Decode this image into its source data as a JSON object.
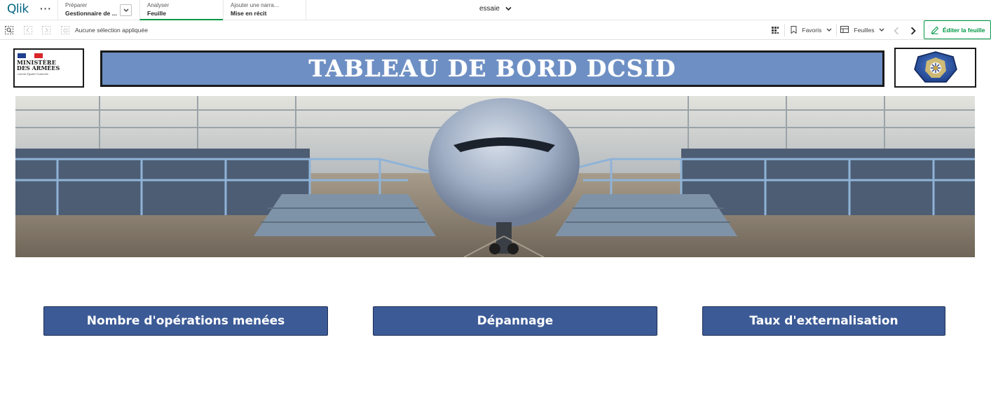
{
  "topnav": {
    "logo": "Qlik",
    "more_label": "···",
    "tabs": [
      {
        "small": "Préparer",
        "big": "Gestionnaire de ..."
      },
      {
        "small": "Analyser",
        "big": "Feuille"
      },
      {
        "small": "Ajouter une narra...",
        "big": "Mise en récit"
      }
    ],
    "app_title": "essaie"
  },
  "toolbar": {
    "selection_text": "Aucune sélection appliquée",
    "favorites_label": "Favoris",
    "sheets_label": "Feuilles",
    "edit_label": "Éditer la feuille"
  },
  "sheet": {
    "ministry_logo": {
      "line1": "MINISTÈRE",
      "line2": "DES ARMÉES",
      "motto": "Liberté Égalité Fraternité"
    },
    "title": "TABLEAU DE BORD DCSID",
    "buttons": {
      "operations": "Nombre d'opérations menées",
      "depannage": "Dépannage",
      "externalisation": "Taux d'externalisation"
    }
  },
  "colors": {
    "accent_green": "#009845",
    "banner_blue": "#6d8fc4",
    "button_blue": "#3c5a96",
    "qlik_teal": "#006580"
  },
  "icons": [
    "smart-search-icon",
    "step-back-icon",
    "step-forward-icon",
    "clear-selections-icon",
    "grid-icon",
    "bookmark-icon",
    "sheets-icon",
    "prev-icon",
    "next-icon",
    "edit-pencil-icon",
    "chevron-down-icon"
  ]
}
